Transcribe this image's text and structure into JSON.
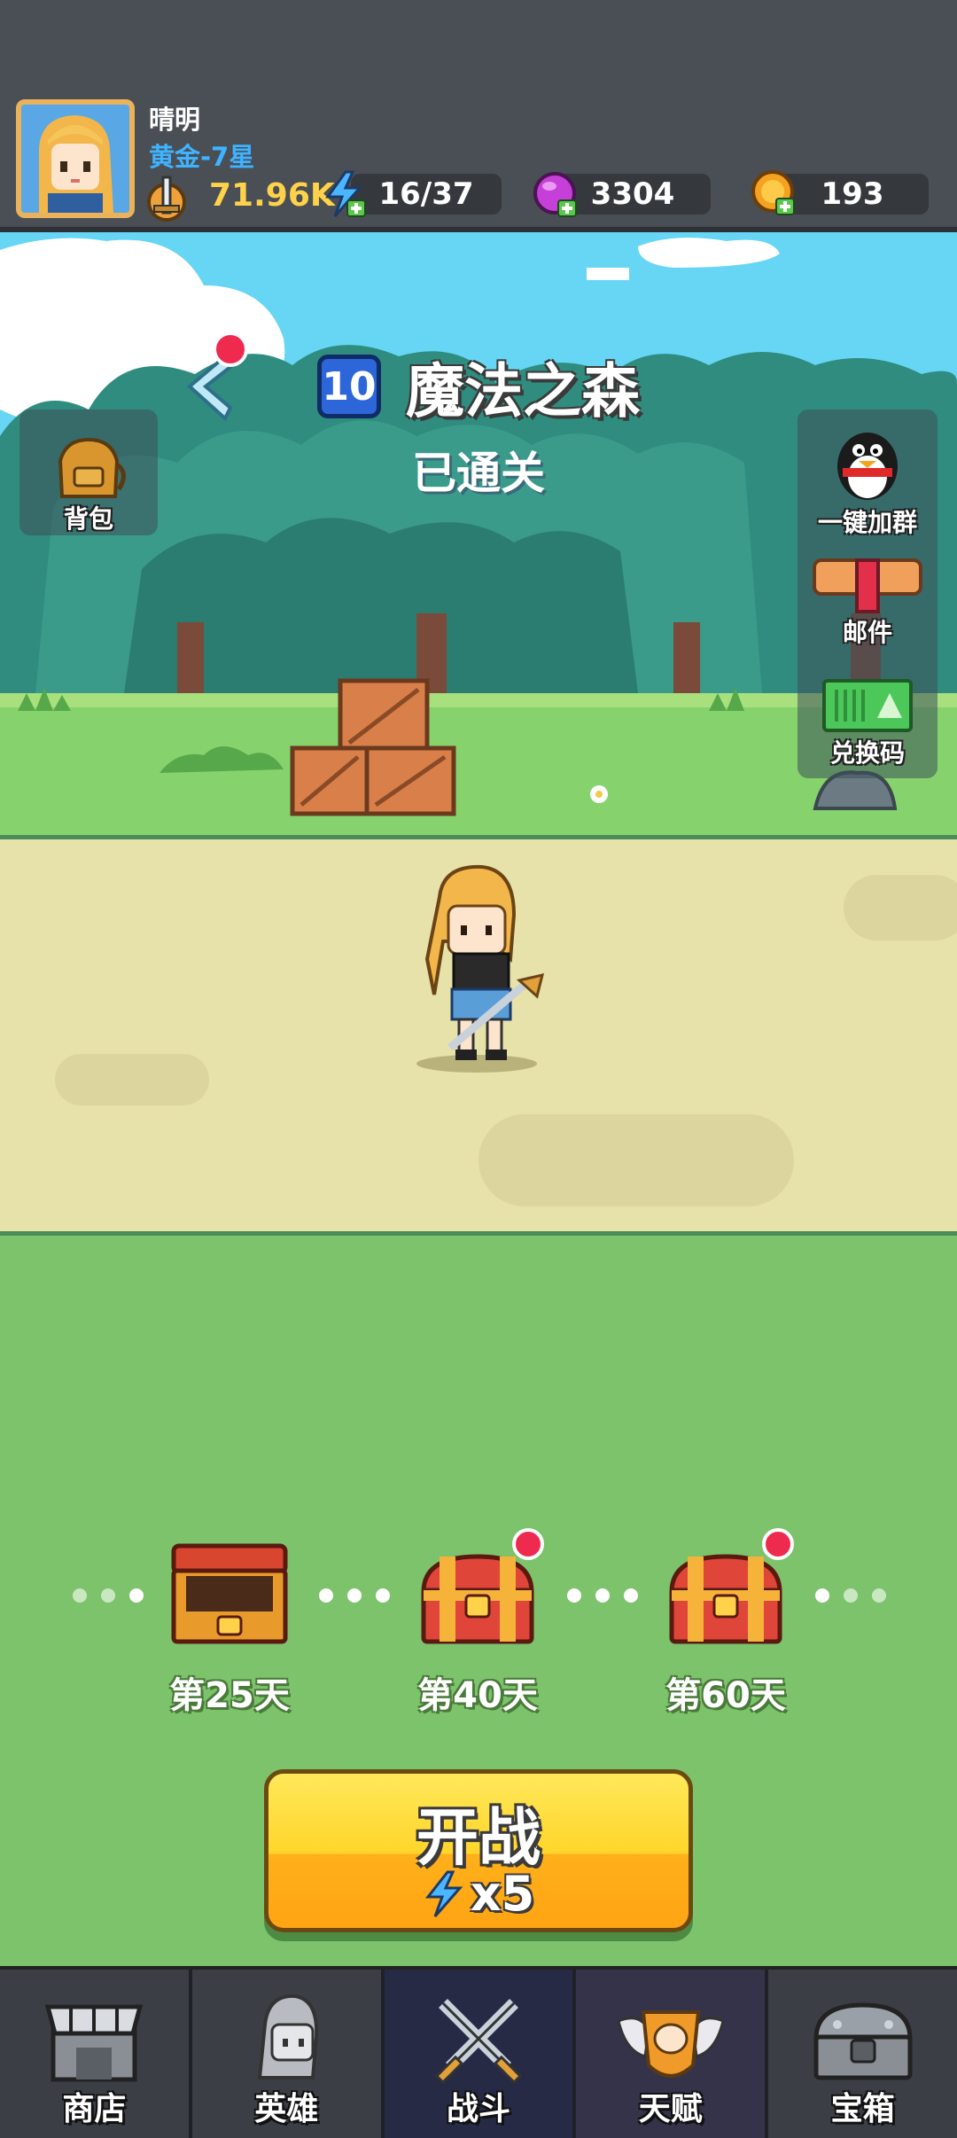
{
  "header": {
    "player_name": "晴明",
    "player_rank": "黄金-7星",
    "power": "71.96K",
    "energy": "16/37",
    "gems": "3304",
    "coins": "193"
  },
  "stage": {
    "number": "10",
    "name": "魔法之森",
    "status": "已通关"
  },
  "side_buttons": {
    "backpack": "背包",
    "join_group": "一键加群",
    "mail": "邮件",
    "redeem_code": "兑换码"
  },
  "rewards": [
    {
      "label": "第25天",
      "opened": true
    },
    {
      "label": "第40天",
      "opened": false,
      "notify": true
    },
    {
      "label": "第60天",
      "opened": false,
      "notify": true
    }
  ],
  "battle": {
    "label": "开战",
    "cost": "x5"
  },
  "nav": {
    "shop": "商店",
    "heroes": "英雄",
    "battle": "战斗",
    "talent": "天赋",
    "chest": "宝箱"
  },
  "colors": {
    "header_bg": "#4a4f55",
    "rank_blue": "#3fb3ff",
    "power_gold": "#ffd24a",
    "field_green": "#7cc36c",
    "button_yellow": "#ffd52a",
    "notify_red": "#ef2a4f"
  }
}
